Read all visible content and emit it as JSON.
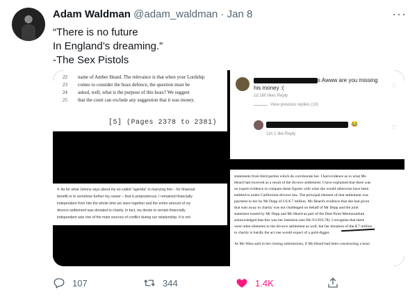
{
  "tweet": {
    "display_name": "Adam Waldman",
    "handle": "@adam_waldman",
    "separator": " · ",
    "date": "Jan 8",
    "lines": [
      "“There is no future",
      "In England’s dreaming.”",
      "-The Sex Pistols"
    ]
  },
  "media": {
    "image1": {
      "lines": [
        {
          "num": "22",
          "text": "name of Amber Heard.  The relevance is that when your Lordship"
        },
        {
          "num": "23",
          "text": "comes to consider the hoax defence, the question must be"
        },
        {
          "num": "24",
          "text": "asked, well, what is the purpose of this hoax?  We suggest"
        },
        {
          "num": "25",
          "text": "that the court can exclude any suggestion that it was money."
        }
      ],
      "pages": "[5]  (Pages 2378 to 2381)"
    },
    "image2": {
      "comment1_tail": "s Awww are you missing",
      "comment1_line2": "his money :(",
      "comment1_meta": "1d    160 likes    Reply",
      "view_replies": "View previous replies (10)",
      "comment2_meta": "11h    1 like    Reply",
      "emoji": "😂"
    },
    "image3": {
      "lines": [
        "4.    As for what Johnny says about my so-called \"agenda\" in marrying him – for financial",
        "benefit or to somehow further my career – that is preposterous. I remained financially",
        "independent from him the whole time we were together and the entire amount of my",
        "divorce settlement was donated to charity. In fact, my desire to remain financially",
        "independent was one of the main sources of conflict during our relationship.   It is not"
      ]
    },
    "image4": {
      "lines": [
        "statements from third parties which do corroborate her.  I had evidence as to what Ms",
        "Heard had received as a result of the divorce settlement. I have explained that there was",
        "no expert evidence to compare these figures with what she would otherwise have been",
        "entitled to under Californian divorce law.  The principal element of that settlement was",
        "payment to her by Mr Depp of US $ 7 million.  Ms Heard's evidence that she had given",
        "that sum away to charity was not challenged on behalf of Mr Depp and the joint",
        "statement issued by Mr Depp and Ms Heard as part of the Deal Point Memorandum",
        "acknowledged that this was her intention (see file 9/139/L78).  I recognise that there",
        "were other elements to the divorce settlement as well, but her donation of the $ 7 million",
        "to charity is hardly the act one would expect of a gold-digger.",
        "As Ms Wass said in her closing submissions, if Ms Heard had been constructing a hoax"
      ]
    }
  },
  "actions": {
    "reply_count": "107",
    "retweet_count": "344",
    "like_count": "1.4K"
  },
  "colors": {
    "like_active": "#f91880",
    "secondary_text": "#536471"
  },
  "icons": [
    "more-icon",
    "reply-icon",
    "retweet-icon",
    "heart-icon",
    "share-icon"
  ]
}
